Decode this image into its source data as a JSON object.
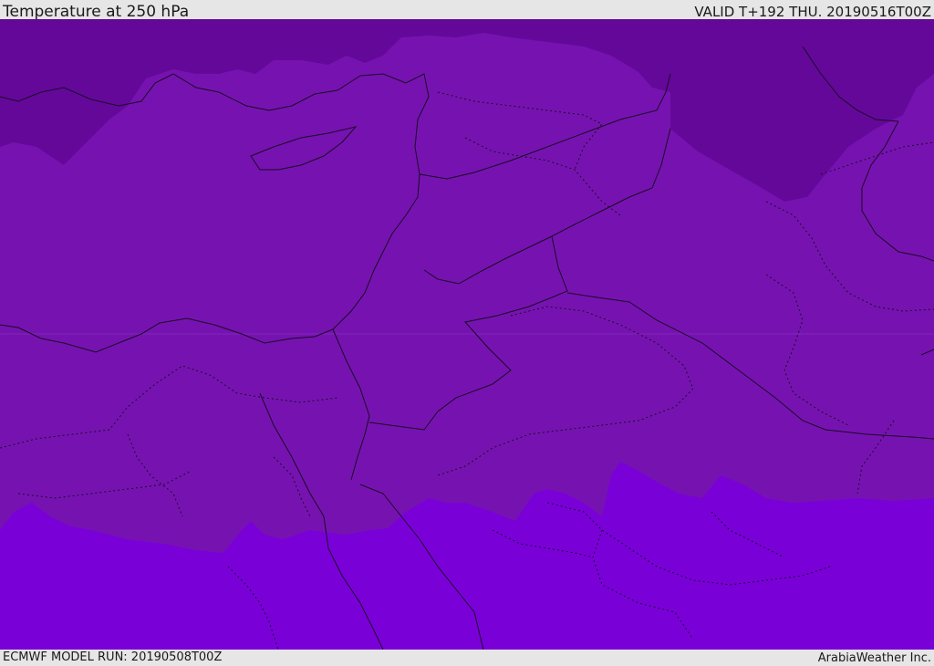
{
  "header": {
    "title": "Temperature at 250 hPa",
    "valid": "VALID T+192 THU. 20190516T00Z"
  },
  "footer": {
    "model_run": "ECMWF MODEL RUN: 20190508T00Z",
    "credit": "ArabiaWeather Inc."
  },
  "map": {
    "field": "temperature",
    "level": "250 hPa",
    "colors": {
      "coldest_band": "#64089a",
      "mid_band": "#7613b0",
      "warm_band": "#7a00d8",
      "coastline": "#1a0a25",
      "borders": "#1a0a25"
    }
  }
}
